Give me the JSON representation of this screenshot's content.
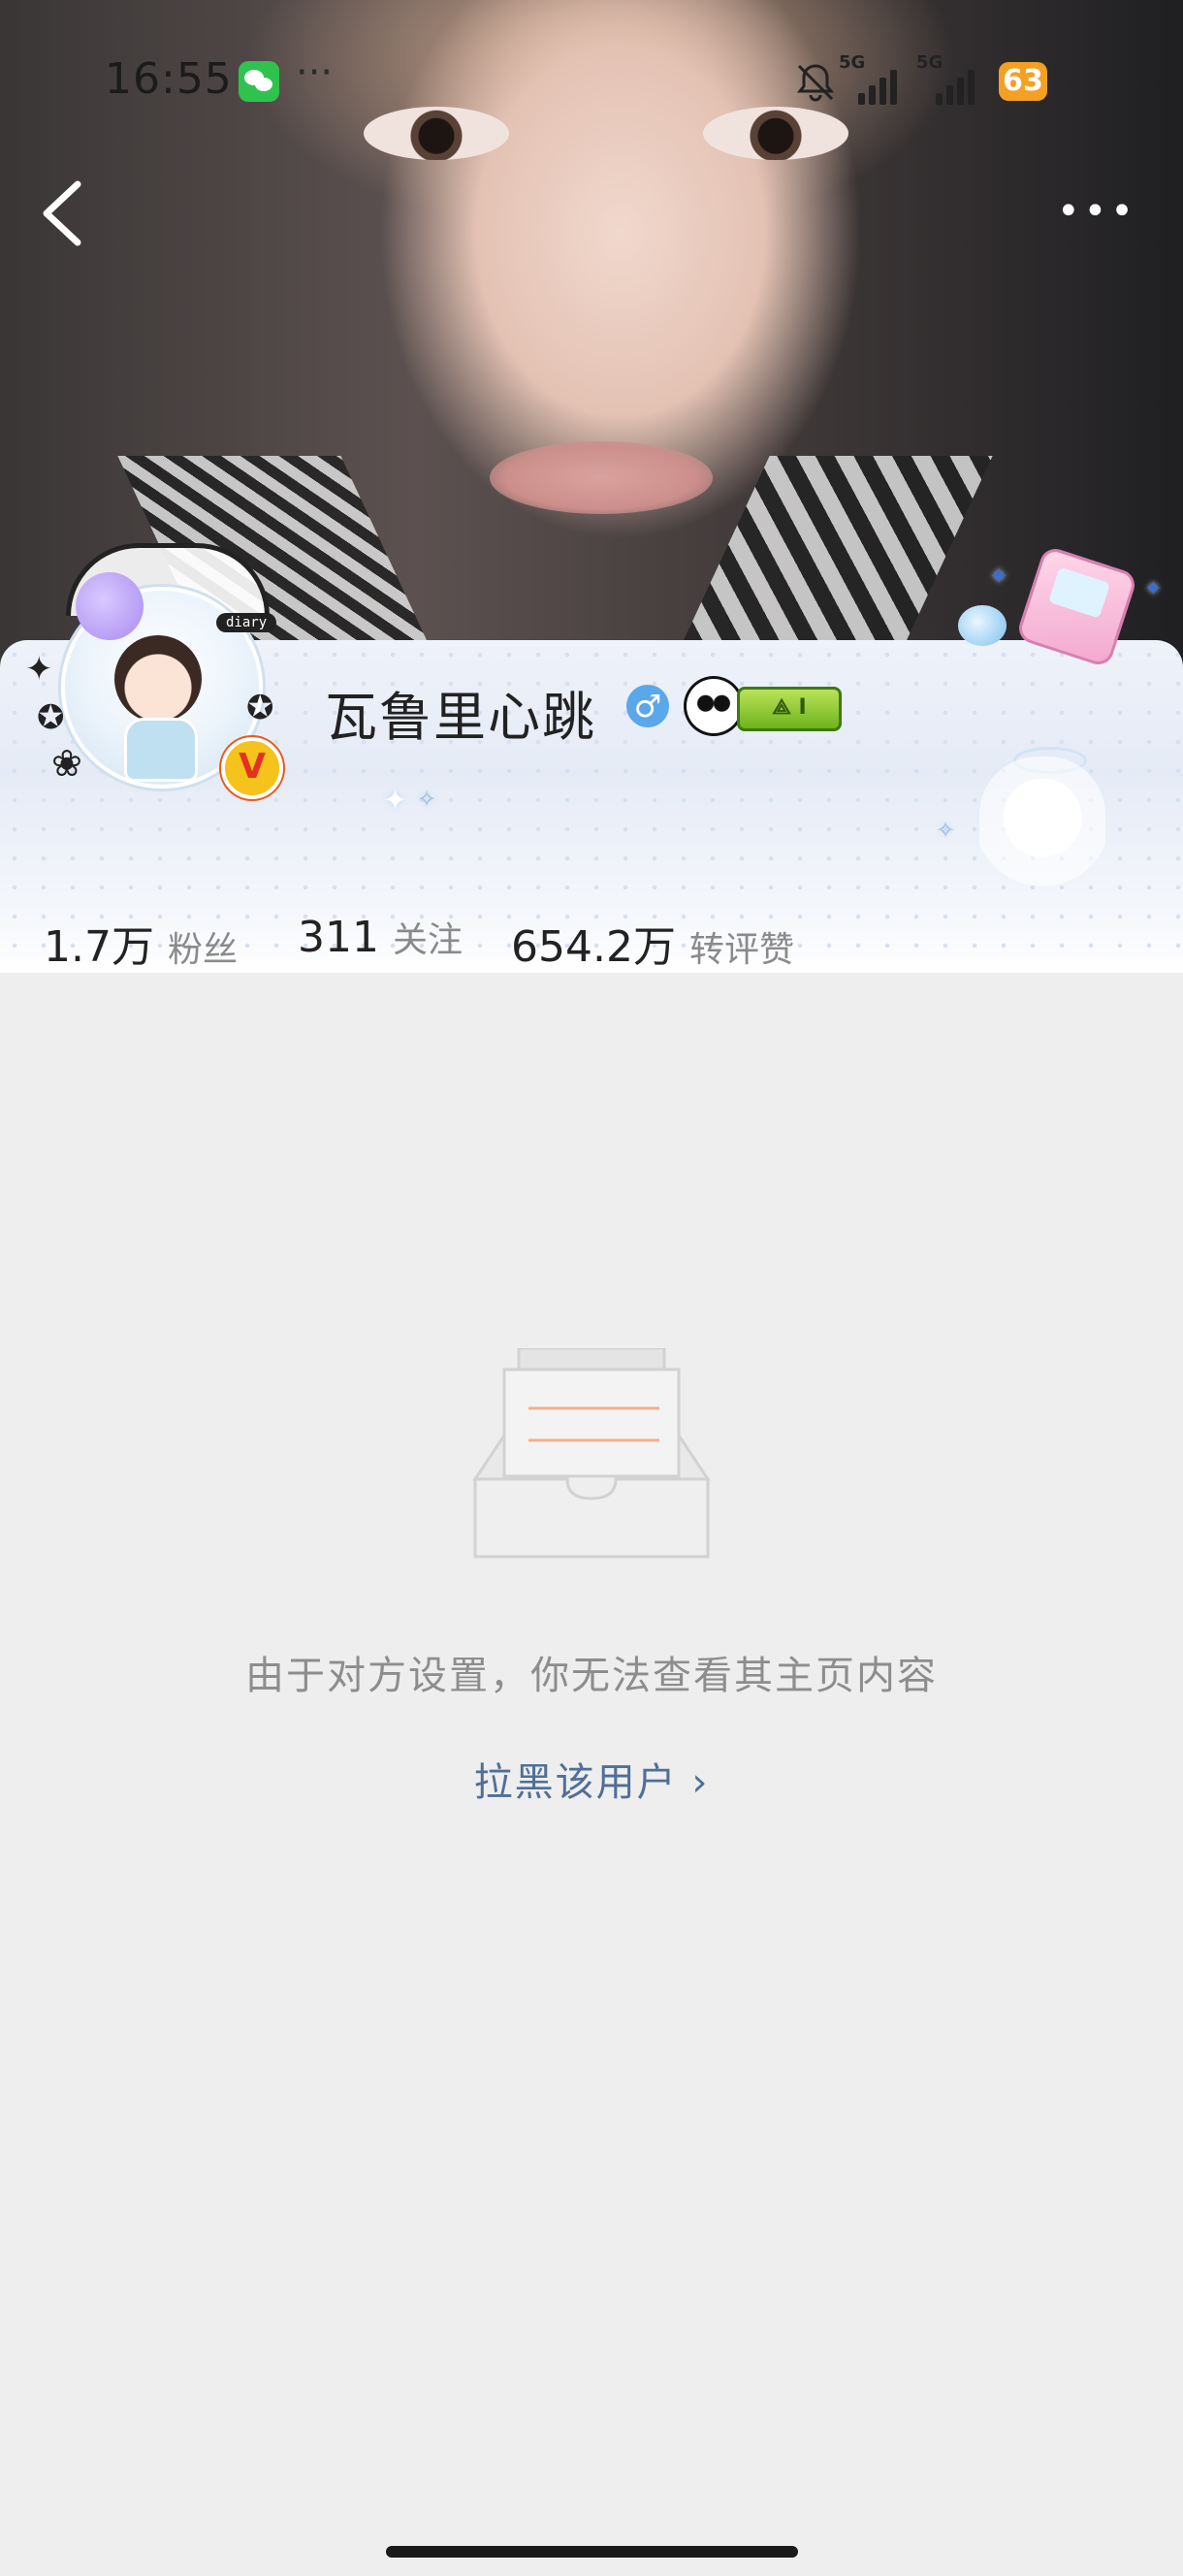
{
  "status_bar": {
    "time": "16:55",
    "more_notifications": "···",
    "network_1": "5G",
    "network_2": "5G",
    "battery": "63",
    "battery_color": "#f4a024"
  },
  "nav": {
    "back_icon": "chevron-left-icon",
    "more_icon": "more-horizontal-icon",
    "more_label": "•••"
  },
  "profile": {
    "name": "瓦鲁里心跳",
    "gender_symbol": "♂",
    "gender_color": "#5aa7ea",
    "avatar_tag": "diary",
    "verified_badge": "V",
    "medal_label": "⟁ I"
  },
  "stats": [
    {
      "value": "1.7万",
      "label": "粉丝"
    },
    {
      "value": "311",
      "label": "关注"
    },
    {
      "value": "654.2万",
      "label": "转评赞"
    }
  ],
  "empty_state": {
    "icon": "empty-inbox-icon",
    "message": "由于对方设置，你无法查看其主页内容",
    "action_label": "拉黑该用户 ›",
    "action_color": "#4f6f98"
  }
}
